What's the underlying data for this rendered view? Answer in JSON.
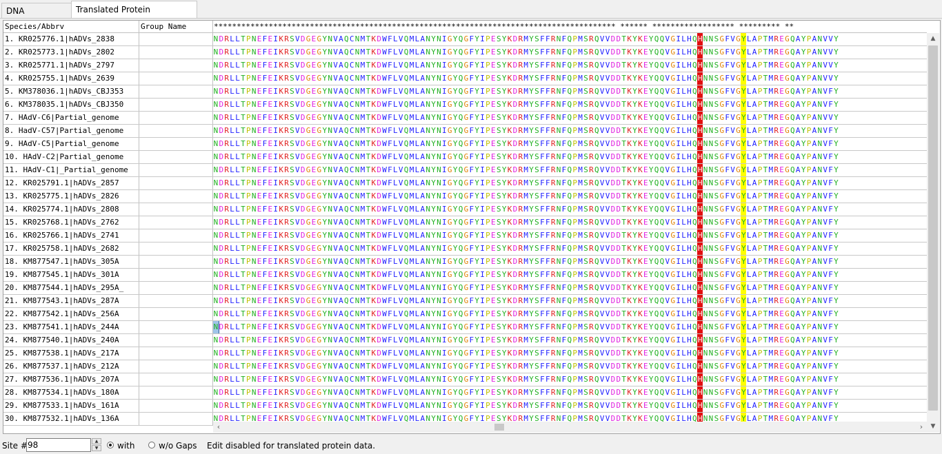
{
  "tabs": [
    {
      "label": "DNA Sequences"
    },
    {
      "label": "Translated Protein Sequences"
    }
  ],
  "grid": {
    "header_species": "Species/Abbrv",
    "header_group": "Group Name",
    "header_stars": "**************************************************************************************** ****** ****************** ********* **",
    "sequence": "NDRLLTPNEFEIKRSVDGEGYNVAQCNMTKDWFLVQMLANYNIGYQGFYIPESYKDRMYSFFRNFQPMSRQVVDDTKYKEYQQVGILHQHNNSGFVGYLAPTMREGQAYPANVPY",
    "rows": [
      {
        "name": "1. KR025776.1|hADVs_2838",
        "seq_variant": "V"
      },
      {
        "name": "2. KR025773.1|hADVs_2802",
        "seq_variant": "V"
      },
      {
        "name": "3. KR025771.1|hADVs_2797",
        "seq_variant": "V"
      },
      {
        "name": "4. KR025755.1|hADVs_2639",
        "seq_variant": "V"
      },
      {
        "name": "5. KM378036.1|hADVs_CBJ353",
        "seq_variant": "F"
      },
      {
        "name": "6. KM378035.1|hADVs_CBJ350",
        "seq_variant": "F"
      },
      {
        "name": "7. HAdV-C6|Partial_genome",
        "seq_variant": "V"
      },
      {
        "name": "8. HadV-C57|Partial_genome",
        "seq_variant": "F"
      },
      {
        "name": "9. HAdV-C5|Partial_genome",
        "seq_variant": "F"
      },
      {
        "name": "10. HAdV-C2|Partial_genome",
        "seq_variant": "F"
      },
      {
        "name": "11. HAdV-C1|_Partial_genome",
        "seq_variant": "F"
      },
      {
        "name": "12. KR025791.1|hADVs_2857",
        "seq_variant": "F"
      },
      {
        "name": "13. KR025775.1|hADVs_2826",
        "seq_variant": "F"
      },
      {
        "name": "14. KR025774.1|hADVs_2808",
        "seq_variant": "F"
      },
      {
        "name": "15. KR025768.1|hADVs_2762",
        "seq_variant": "F"
      },
      {
        "name": "16. KR025766.1|hADVs_2741",
        "seq_variant": "F"
      },
      {
        "name": "17. KR025758.1|hADVs_2682",
        "seq_variant": "F"
      },
      {
        "name": "18. KM877547.1|hADVs_305A",
        "seq_variant": "F"
      },
      {
        "name": "19. KM877545.1|hADVs_301A",
        "seq_variant": "F"
      },
      {
        "name": "20. KM877544.1|hADVs_295A_",
        "seq_variant": "F"
      },
      {
        "name": "21. KM877543.1|hADVs_287A",
        "seq_variant": "F"
      },
      {
        "name": "22. KM877542.1|hADVs_256A",
        "seq_variant": "F"
      },
      {
        "name": "23. KM877541.1|hADVs_244A",
        "seq_variant": "F"
      },
      {
        "name": "24. KM877540.1|hADVs_240A",
        "seq_variant": "F"
      },
      {
        "name": "25. KM877538.1|hADVs_217A",
        "seq_variant": "F"
      },
      {
        "name": "26. KM877537.1|hADVs_212A",
        "seq_variant": "F"
      },
      {
        "name": "27. KM877536.1|hADVs_207A",
        "seq_variant": "F"
      },
      {
        "name": "28. KM877534.1|hADVs_180A",
        "seq_variant": "F"
      },
      {
        "name": "29. KM877533.1|hADVs_161A",
        "seq_variant": "F"
      },
      {
        "name": "30. KM877532.1|hADVs_136A",
        "seq_variant": "F"
      }
    ]
  },
  "colors": {
    "hydrophobic": "#c8c800",
    "positive": "#2050ff",
    "negative": "#e02020",
    "polar": "#20b020",
    "special": "#e060e0",
    "other": "#000000",
    "highlight_red": "#e01010",
    "highlight_yellow": "#ffff00"
  },
  "statusbar": {
    "site_label": "Site #",
    "site_value": "98",
    "with_label": "with",
    "without_label": "w/o Gaps",
    "message": "Edit disabled for translated protein data."
  }
}
